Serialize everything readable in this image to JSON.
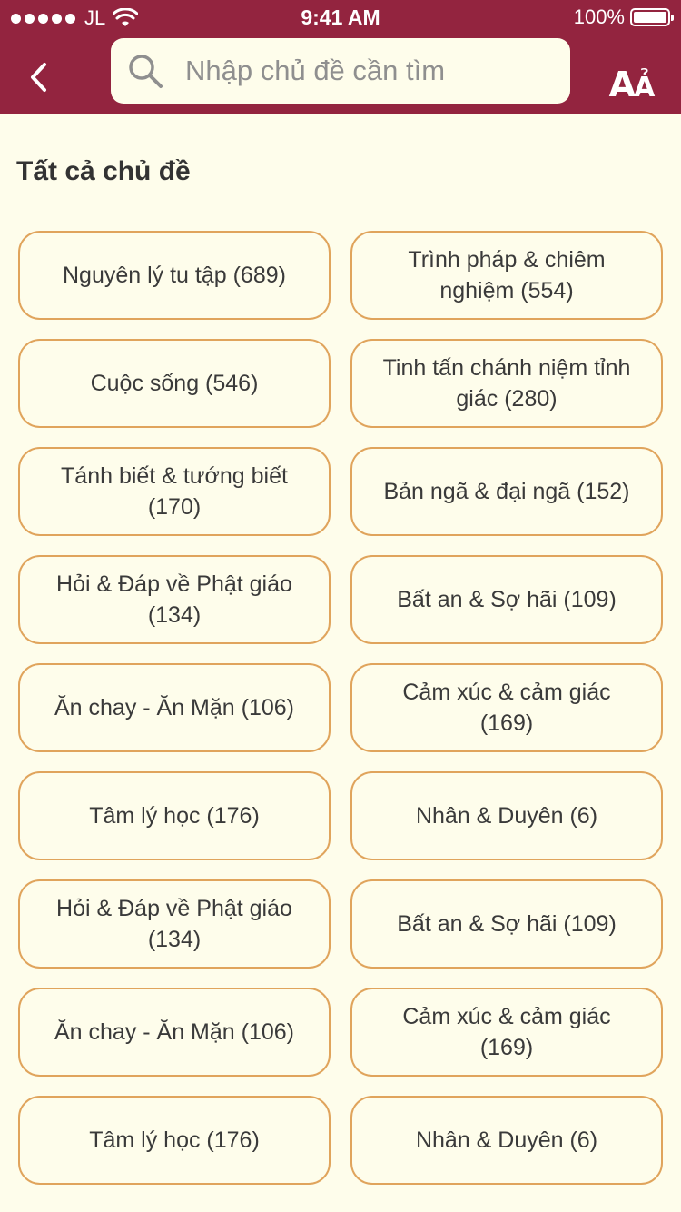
{
  "status_bar": {
    "carrier": "JL",
    "time": "9:41 AM",
    "battery": "100%",
    "signal_bars": 5
  },
  "header": {
    "back_icon": "chevron-left-icon",
    "search": {
      "placeholder": "Nhập chủ đề cần tìm",
      "value": ""
    },
    "font_size_label_big": "A",
    "font_size_label_small": "Ả"
  },
  "section_title": "Tất cả chủ đề",
  "topics": [
    {
      "label": "Nguyên lý tu tập (689)"
    },
    {
      "label": "Trình pháp & chiêm nghiệm (554)"
    },
    {
      "label": "Cuộc sống (546)"
    },
    {
      "label": "Tinh tấn chánh niệm tỉnh giác (280)"
    },
    {
      "label": "Tánh biết & tướng biết (170)"
    },
    {
      "label": "Bản ngã & đại ngã (152)"
    },
    {
      "label": "Hỏi & Đáp về Phật giáo (134)"
    },
    {
      "label": "Bất an & Sợ hãi (109)"
    },
    {
      "label": "Ăn chay - Ăn Mặn (106)"
    },
    {
      "label": "Cảm xúc & cảm giác (169)"
    },
    {
      "label": "Tâm lý học (176)"
    },
    {
      "label": "Nhân & Duyên (6)"
    },
    {
      "label": "Hỏi & Đáp về Phật giáo (134)"
    },
    {
      "label": "Bất an & Sợ hãi (109)"
    },
    {
      "label": "Ăn chay - Ăn Mặn (106)"
    },
    {
      "label": "Cảm xúc & cảm giác (169)"
    },
    {
      "label": "Tâm lý học (176)"
    },
    {
      "label": "Nhân & Duyên (6)"
    }
  ],
  "colors": {
    "header_bg": "#93243f",
    "page_bg": "#fefdeb",
    "chip_border": "#e0a45c",
    "text": "#3a3a3a"
  }
}
